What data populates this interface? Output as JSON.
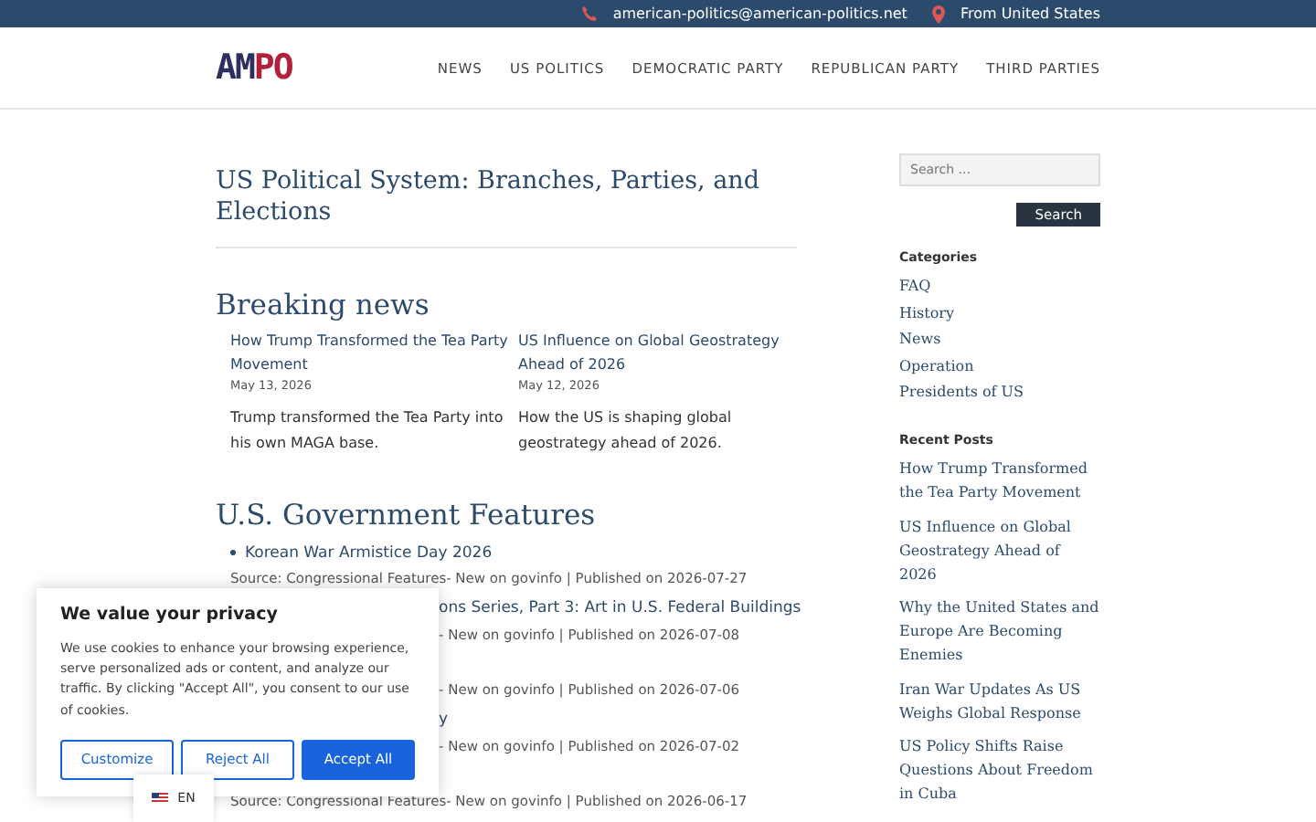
{
  "top_bar": {
    "email": "american-politics@american-politics.net",
    "location": "From United States"
  },
  "header": {
    "logo_dark": "AM",
    "logo_red": "PO",
    "nav": [
      "NEWS",
      "US POLITICS",
      "DEMOCRATIC PARTY",
      "REPUBLICAN PARTY",
      "THIRD PARTIES"
    ]
  },
  "page_title": "US Political System: Branches, Parties, and Elections",
  "breaking_news": {
    "heading": "Breaking news",
    "posts": [
      {
        "title": "How Trump Transformed the Tea Party Movement",
        "date": "May 13, 2026",
        "excerpt": "Trump transformed the Tea Party into his own MAGA base."
      },
      {
        "title": "US Influence on Global Geostrategy Ahead of 2026",
        "date": "May 12, 2026",
        "excerpt": "How the US is shaping global geostrategy ahead of 2026."
      }
    ]
  },
  "features": {
    "heading": "U.S. Government Features",
    "items": [
      {
        "title": "Korean War Armistice Day 2026",
        "source": "Source: Congressional Features- New on govinfo | Published on 2026-07-27",
        "covered": false
      },
      {
        "title": "ons Series, Part 3: Art in U.S. Federal Buildings",
        "source": "- New on govinfo | Published on 2026-07-08",
        "covered": true
      },
      {
        "source": "- New on govinfo | Published on 2026-07-06",
        "covered": true
      },
      {
        "title": "y",
        "source": "- New on govinfo | Published on 2026-07-02",
        "covered": true
      },
      {
        "source": "Source: Congressional Features- New on govinfo | Published on 2026-06-17",
        "covered": false
      }
    ]
  },
  "sidebar": {
    "search": {
      "placeholder": "Search ...",
      "button": "Search"
    },
    "categories": {
      "heading": "Categories",
      "items": [
        "FAQ",
        "History",
        "News",
        "Operation",
        "Presidents of US"
      ]
    },
    "recent_posts": {
      "heading": "Recent Posts",
      "items": [
        "How Trump Transformed the Tea Party Movement",
        "US Influence on Global Geostrategy Ahead of 2026",
        "Why the United States and Europe Are Becoming Enemies",
        "Iran War Updates As US Weighs Global Response",
        "US Policy Shifts Raise Questions About Freedom in Cuba"
      ]
    }
  },
  "cookie_banner": {
    "title": "We value your privacy",
    "text": "We use cookies to enhance your browsing experience, serve personalized ads or content, and analyze our traffic. By clicking \"Accept All\", you consent to our use of cookies.",
    "buttons": [
      "Customize",
      "Reject All",
      "Accept All"
    ]
  },
  "language": {
    "code": "EN"
  }
}
